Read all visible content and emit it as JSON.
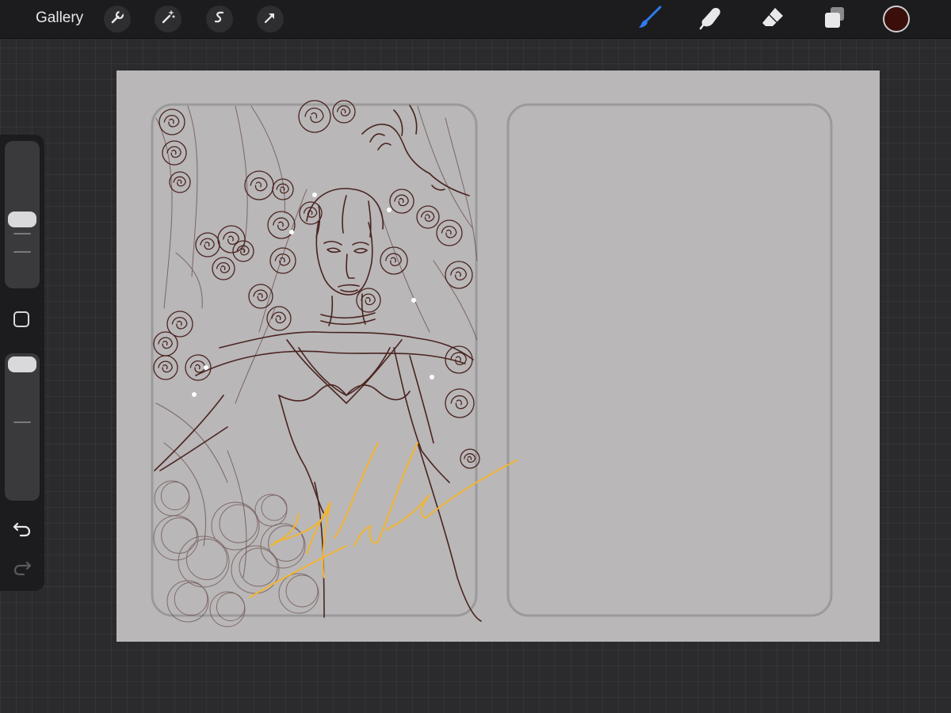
{
  "toolbar": {
    "gallery_label": "Gallery",
    "left_tools": [
      {
        "name": "actions",
        "icon": "wrench-icon"
      },
      {
        "name": "adjustments",
        "icon": "magic-wand-icon"
      },
      {
        "name": "selection",
        "icon": "selection-s-icon"
      },
      {
        "name": "transform",
        "icon": "arrow-cursor-icon"
      }
    ],
    "right_tools": [
      {
        "name": "brush",
        "icon": "brush-icon",
        "active": true
      },
      {
        "name": "smudge",
        "icon": "smudge-finger-icon",
        "active": false
      },
      {
        "name": "eraser",
        "icon": "eraser-icon",
        "active": false
      },
      {
        "name": "layers",
        "icon": "layers-icon",
        "active": false
      }
    ],
    "current_color": "#3a0f0b",
    "active_tool_color": "#2f7bf2"
  },
  "sidebar": {
    "brush_size_icon": "brush-size-slider",
    "opacity_icon": "opacity-slider",
    "modify_icon": "square-modify-icon",
    "undo_icon": "undo-arrow-icon",
    "redo_icon": "redo-arrow-icon"
  },
  "canvas": {
    "background": "#b9b7b8",
    "line_color": "#4a2420",
    "signature_color": "#f2b530",
    "panel_count": 2
  }
}
